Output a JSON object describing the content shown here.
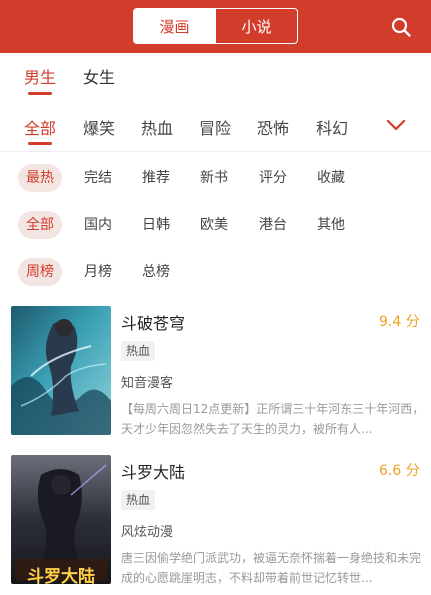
{
  "header": {
    "tabs": [
      {
        "label": "漫画",
        "active": true
      },
      {
        "label": "小说",
        "active": false
      }
    ],
    "search_icon": "search-icon",
    "accent_color": "#d23c2a"
  },
  "gender_tabs": [
    {
      "label": "男生",
      "active": true
    },
    {
      "label": "女生",
      "active": false
    }
  ],
  "categories": [
    {
      "label": "全部",
      "active": true
    },
    {
      "label": "爆笑",
      "active": false
    },
    {
      "label": "热血",
      "active": false
    },
    {
      "label": "冒险",
      "active": false
    },
    {
      "label": "恐怖",
      "active": false
    },
    {
      "label": "科幻",
      "active": false
    }
  ],
  "expand_icon": "chevron-down-icon",
  "filters": {
    "sort": [
      {
        "label": "最热",
        "active": true
      },
      {
        "label": "完结",
        "active": false
      },
      {
        "label": "推荐",
        "active": false
      },
      {
        "label": "新书",
        "active": false
      },
      {
        "label": "评分",
        "active": false
      },
      {
        "label": "收藏",
        "active": false
      }
    ],
    "region": [
      {
        "label": "全部",
        "active": true
      },
      {
        "label": "国内",
        "active": false
      },
      {
        "label": "日韩",
        "active": false
      },
      {
        "label": "欧美",
        "active": false
      },
      {
        "label": "港台",
        "active": false
      },
      {
        "label": "其他",
        "active": false
      }
    ],
    "rank": [
      {
        "label": "周榜",
        "active": true
      },
      {
        "label": "月榜",
        "active": false
      },
      {
        "label": "总榜",
        "active": false
      }
    ]
  },
  "books": [
    {
      "title": "斗破苍穹",
      "score": "9.4 分",
      "tag": "热血",
      "author": "知音漫客",
      "description": "【每周六周日12点更新】正所谓三十年河东三十年河西，天才少年因忽然失去了天生的灵力，被所有人..."
    },
    {
      "title": "斗罗大陆",
      "score": "6.6 分",
      "tag": "热血",
      "author": "风炫动漫",
      "description": "唐三因偷学绝门派武功，被逼无奈怀揣着一身绝技和未完成的心愿跳崖明志，不料却带着前世记忆转世...",
      "cover_text": "斗罗大陆"
    }
  ]
}
